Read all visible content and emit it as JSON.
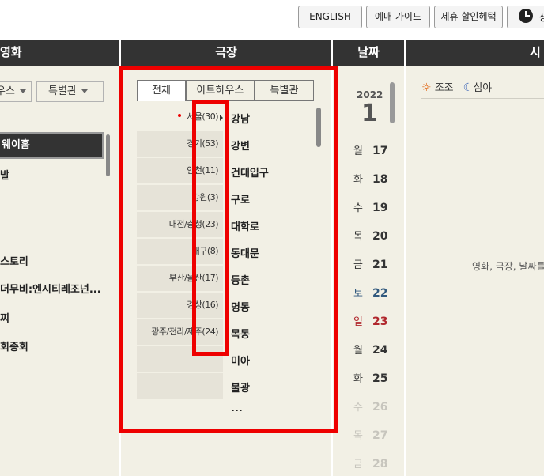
{
  "topbar": {
    "english": "ENGLISH",
    "guide": "예매 가이드",
    "discount": "제휴 할인혜택",
    "schedule_partial": "상"
  },
  "headers": {
    "movie": "영화",
    "theater": "극장",
    "date": "날짜",
    "time_partial": "시"
  },
  "movie_panel": {
    "filters": [
      "우스",
      "특별관"
    ],
    "selected": "웨이홈",
    "items": [
      "발",
      "스토리",
      "더무비:엔시티레조넌...",
      "찌",
      "회종회"
    ]
  },
  "theater_panel": {
    "tabs": [
      "전체",
      "아트하우스",
      "특별관"
    ],
    "regions": [
      "서울(30)",
      "경기(53)",
      "인천(11)",
      "강원(3)",
      "대전/충청(23)",
      "대구(8)",
      "부산/울산(17)",
      "경상(16)",
      "광주/전라/제주(24)",
      "",
      ""
    ],
    "cinemas": [
      "강남",
      "강변",
      "건대입구",
      "구로",
      "대학로",
      "동대문",
      "등촌",
      "명동",
      "목동",
      "미아",
      "불광",
      "..."
    ]
  },
  "date_panel": {
    "year": "2022",
    "month": "1",
    "days": [
      {
        "dow": "월",
        "num": "17",
        "kind": "normal"
      },
      {
        "dow": "화",
        "num": "18",
        "kind": "normal"
      },
      {
        "dow": "수",
        "num": "19",
        "kind": "normal"
      },
      {
        "dow": "목",
        "num": "20",
        "kind": "normal"
      },
      {
        "dow": "금",
        "num": "21",
        "kind": "normal"
      },
      {
        "dow": "토",
        "num": "22",
        "kind": "sat"
      },
      {
        "dow": "일",
        "num": "23",
        "kind": "sun"
      },
      {
        "dow": "월",
        "num": "24",
        "kind": "normal"
      },
      {
        "dow": "화",
        "num": "25",
        "kind": "normal"
      },
      {
        "dow": "수",
        "num": "26",
        "kind": "dis"
      },
      {
        "dow": "목",
        "num": "27",
        "kind": "dis"
      },
      {
        "dow": "금",
        "num": "28",
        "kind": "dis"
      }
    ]
  },
  "time_panel": {
    "morning": "조조",
    "night": "심야",
    "message": "영화, 극장, 날짜를"
  },
  "colors": {
    "header_bg": "#333333",
    "panel_bg": "#f2f0e5",
    "annotation": "#ee0000",
    "saturday": "#31597e",
    "sunday": "#b0262c"
  }
}
